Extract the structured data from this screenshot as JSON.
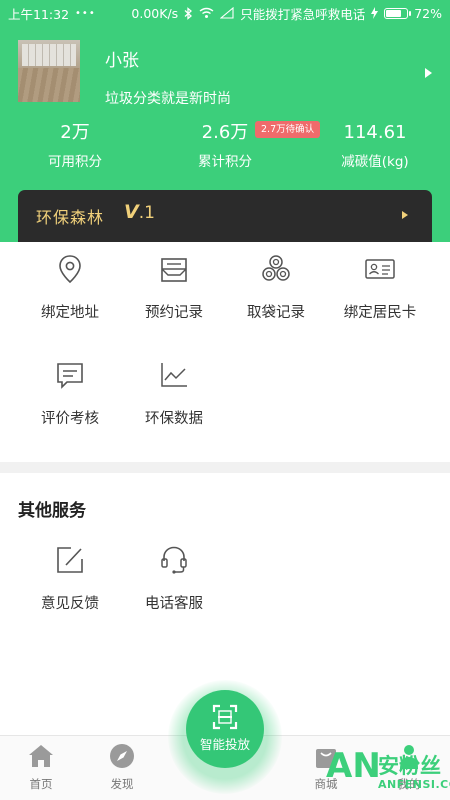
{
  "status_bar": {
    "time": "上午11:32",
    "speed": "0.00K/s",
    "carrier": "只能拨打紧急呼救电话",
    "battery": "72%",
    "battery_level": 0.72
  },
  "profile": {
    "name": "小张",
    "motto": "垃圾分类就是新时尚"
  },
  "stats": [
    {
      "value": "2万",
      "label": "可用积分"
    },
    {
      "value": "2.6万",
      "label": "累计积分"
    },
    {
      "value": "114.61",
      "label": "减碳值(kg)"
    }
  ],
  "pending_badge": "2.7万待确认",
  "forest": {
    "title": "环保森林",
    "level_letter": "V",
    "level_num": ".1"
  },
  "functions": [
    {
      "label": "绑定地址",
      "icon": "location-pin-icon"
    },
    {
      "label": "预约记录",
      "icon": "appointment-record-icon"
    },
    {
      "label": "取袋记录",
      "icon": "bag-rolls-icon"
    },
    {
      "label": "绑定居民卡",
      "icon": "resident-card-icon"
    },
    {
      "label": "评价考核",
      "icon": "comment-icon"
    },
    {
      "label": "环保数据",
      "icon": "line-chart-icon"
    }
  ],
  "other_services": {
    "title": "其他服务",
    "items": [
      {
        "label": "意见反馈",
        "icon": "feedback-edit-icon"
      },
      {
        "label": "电话客服",
        "icon": "headset-icon"
      }
    ]
  },
  "bottom_nav": {
    "home": "首页",
    "discover": "发现",
    "center": "智能投放",
    "mall": "商城",
    "mine": "我的"
  },
  "watermark": {
    "an": "AN",
    "cn": "安粉丝",
    "en": "ANFENSI.COM"
  },
  "colors": {
    "brand_green": "#3ccf7b",
    "badge_red": "#ef6b6b",
    "forest_gold": "#f0d07a",
    "forest_card": "#2b2b2b"
  }
}
